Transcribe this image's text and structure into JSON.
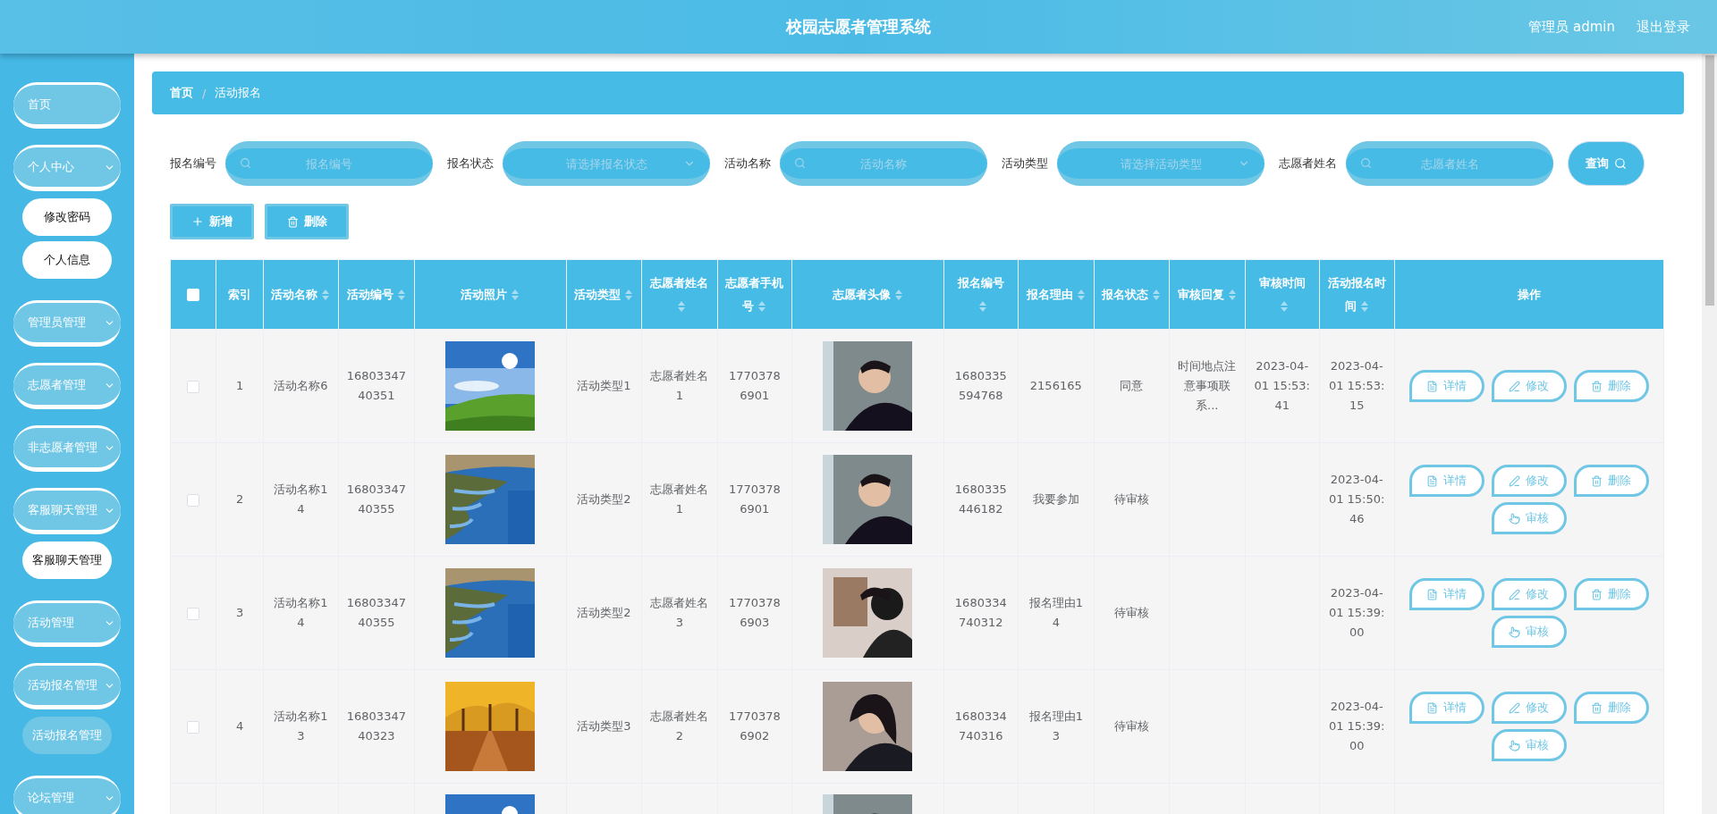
{
  "header": {
    "title": "校园志愿者管理系统",
    "user": "管理员 admin",
    "logout": "退出登录"
  },
  "sidebar": {
    "items": [
      {
        "label": "首页",
        "kind": "link"
      },
      {
        "label": "个人中心",
        "kind": "group",
        "children": [
          {
            "label": "修改密码",
            "selected": false
          },
          {
            "label": "个人信息",
            "selected": false
          }
        ]
      },
      {
        "label": "管理员管理",
        "kind": "group"
      },
      {
        "label": "志愿者管理",
        "kind": "group"
      },
      {
        "label": "非志愿者管理",
        "kind": "group"
      },
      {
        "label": "客服聊天管理",
        "kind": "group",
        "children": [
          {
            "label": "客服聊天管理",
            "selected": false
          }
        ]
      },
      {
        "label": "活动管理",
        "kind": "group"
      },
      {
        "label": "活动报名管理",
        "kind": "group",
        "children": [
          {
            "label": "活动报名管理",
            "selected": true
          }
        ]
      },
      {
        "label": "论坛管理",
        "kind": "group"
      }
    ]
  },
  "breadcrumb": {
    "items": [
      "首页",
      "活动报名"
    ],
    "separator": "/"
  },
  "filters": [
    {
      "label": "报名编号",
      "kind": "search",
      "placeholder": "报名编号"
    },
    {
      "label": "报名状态",
      "kind": "select",
      "placeholder": "请选择报名状态"
    },
    {
      "label": "活动名称",
      "kind": "search",
      "placeholder": "活动名称"
    },
    {
      "label": "活动类型",
      "kind": "select",
      "placeholder": "请选择活动类型"
    },
    {
      "label": "志愿者姓名",
      "kind": "search",
      "placeholder": "志愿者姓名"
    }
  ],
  "query_button": "查询",
  "toolbar": [
    {
      "label": "新增",
      "kind": "add"
    },
    {
      "label": "删除",
      "kind": "delete"
    }
  ],
  "table": {
    "select_all": {
      "checked": false
    },
    "columns": [
      {
        "label": "索引",
        "sortable": false
      },
      {
        "label": "活动名称",
        "sortable": true
      },
      {
        "label": "活动编号",
        "sortable": true
      },
      {
        "label": "活动照片",
        "sortable": true
      },
      {
        "label": "活动类型",
        "sortable": true
      },
      {
        "label": "志愿者姓名",
        "sortable": true
      },
      {
        "label": "志愿者手机号",
        "sortable": true
      },
      {
        "label": "志愿者头像",
        "sortable": true
      },
      {
        "label": "报名编号",
        "sortable": true
      },
      {
        "label": "报名理由",
        "sortable": true
      },
      {
        "label": "报名状态",
        "sortable": true
      },
      {
        "label": "审核回复",
        "sortable": true
      },
      {
        "label": "审核时间",
        "sortable": true
      },
      {
        "label": "活动报名时间",
        "sortable": true
      },
      {
        "label": "操作",
        "sortable": false
      }
    ],
    "rows": [
      {
        "checked": false,
        "index": "1",
        "activity_name": "活动名称6",
        "activity_no": "1680334740351",
        "photo": {
          "kind": "picture"
        },
        "activity_type": "活动类型1",
        "volunteer_name": "志愿者姓名1",
        "phone": "17703786901",
        "avatar": {
          "kind": "picture"
        },
        "signup_no": "1680335594768",
        "reason": "2156165",
        "status": "同意",
        "reply": "时间地点注意事项联系...",
        "review_time": "2023-04-01 15:53:41",
        "signup_time": "2023-04-01 15:53:15",
        "actions": [
          {
            "label": "详情",
            "kind": "detail"
          },
          {
            "label": "修改",
            "kind": "edit"
          },
          {
            "label": "删除",
            "kind": "delete"
          }
        ]
      },
      {
        "checked": false,
        "index": "2",
        "activity_name": "活动名称14",
        "activity_no": "1680334740355",
        "photo": {
          "kind": "picture"
        },
        "activity_type": "活动类型2",
        "volunteer_name": "志愿者姓名1",
        "phone": "17703786901",
        "avatar": {
          "kind": "picture"
        },
        "signup_no": "1680335446182",
        "reason": "我要参加",
        "status": "待审核",
        "signup_time": "2023-04-01 15:50:46",
        "actions": [
          {
            "label": "详情",
            "kind": "detail"
          },
          {
            "label": "修改",
            "kind": "edit"
          },
          {
            "label": "删除",
            "kind": "delete"
          },
          {
            "label": "审核",
            "kind": "review"
          }
        ]
      },
      {
        "checked": false,
        "index": "3",
        "activity_name": "活动名称14",
        "activity_no": "1680334740355",
        "photo": {
          "kind": "picture"
        },
        "activity_type": "活动类型2",
        "volunteer_name": "志愿者姓名3",
        "phone": "17703786903",
        "avatar": {
          "kind": "picture"
        },
        "signup_no": "1680334740312",
        "reason": "报名理由14",
        "status": "待审核",
        "signup_time": "2023-04-01 15:39:00",
        "actions": [
          {
            "label": "详情",
            "kind": "detail"
          },
          {
            "label": "修改",
            "kind": "edit"
          },
          {
            "label": "删除",
            "kind": "delete"
          },
          {
            "label": "审核",
            "kind": "review"
          }
        ]
      },
      {
        "checked": false,
        "index": "4",
        "activity_name": "活动名称13",
        "activity_no": "1680334740323",
        "photo": {
          "kind": "picture"
        },
        "activity_type": "活动类型3",
        "volunteer_name": "志愿者姓名2",
        "phone": "17703786902",
        "avatar": {
          "kind": "picture"
        },
        "signup_no": "1680334740316",
        "reason": "报名理由13",
        "status": "待审核",
        "signup_time": "2023-04-01 15:39:00",
        "actions": [
          {
            "label": "详情",
            "kind": "detail"
          },
          {
            "label": "修改",
            "kind": "edit"
          },
          {
            "label": "删除",
            "kind": "delete"
          },
          {
            "label": "审核",
            "kind": "review"
          }
        ]
      },
      {
        "photo": {
          "kind": "picture"
        },
        "avatar": {
          "kind": "picture"
        }
      }
    ]
  }
}
